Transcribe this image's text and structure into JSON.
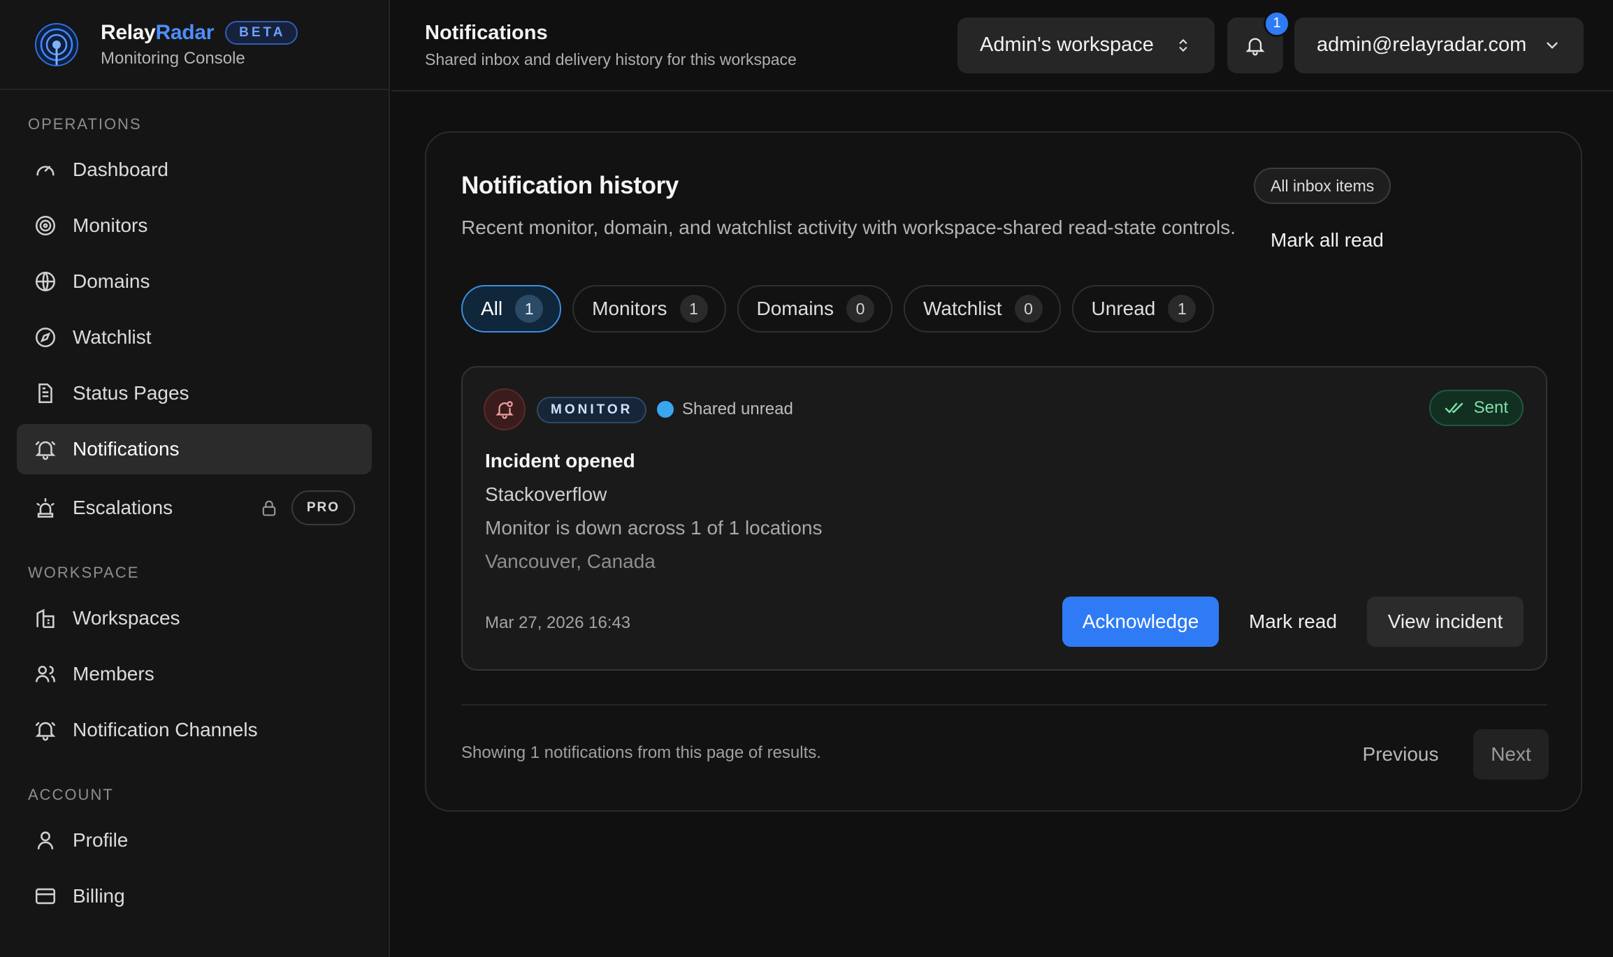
{
  "brand": {
    "name_part1": "Relay",
    "name_part2": "Radar",
    "badge": "BETA",
    "subtitle": "Monitoring Console",
    "logo_icon": "radar-icon"
  },
  "sidebar": {
    "sections": [
      {
        "heading": "OPERATIONS",
        "items": [
          {
            "label": "Dashboard",
            "icon": "gauge-icon"
          },
          {
            "label": "Monitors",
            "icon": "target-icon"
          },
          {
            "label": "Domains",
            "icon": "globe-icon"
          },
          {
            "label": "Watchlist",
            "icon": "compass-icon"
          },
          {
            "label": "Status Pages",
            "icon": "document-icon"
          },
          {
            "label": "Notifications",
            "icon": "bell-icon",
            "active": true
          },
          {
            "label": "Escalations",
            "icon": "siren-icon",
            "badge": "PRO",
            "locked": true
          }
        ]
      },
      {
        "heading": "WORKSPACE",
        "items": [
          {
            "label": "Workspaces",
            "icon": "building-icon"
          },
          {
            "label": "Members",
            "icon": "users-icon"
          },
          {
            "label": "Notification Channels",
            "icon": "bell-icon"
          }
        ]
      },
      {
        "heading": "ACCOUNT",
        "items": [
          {
            "label": "Profile",
            "icon": "user-icon"
          },
          {
            "label": "Billing",
            "icon": "credit-card-icon"
          }
        ]
      }
    ]
  },
  "header": {
    "title": "Notifications",
    "subtitle": "Shared inbox and delivery history for this workspace",
    "workspace": "Admin's workspace",
    "notification_count": "1",
    "user_email": "admin@relayradar.com"
  },
  "history": {
    "title": "Notification history",
    "description": "Recent monitor, domain, and watchlist activity with workspace-shared read-state controls.",
    "filter_pill": "All inbox items",
    "mark_all": "Mark all read",
    "tabs": [
      {
        "label": "All",
        "count": "1",
        "active": true
      },
      {
        "label": "Monitors",
        "count": "1"
      },
      {
        "label": "Domains",
        "count": "0"
      },
      {
        "label": "Watchlist",
        "count": "0"
      },
      {
        "label": "Unread",
        "count": "1"
      }
    ],
    "notification": {
      "tag": "MONITOR",
      "state": "Shared unread",
      "delivery": "Sent",
      "title": "Incident opened",
      "name": "Stackoverflow",
      "message": "Monitor is down across 1 of 1 locations",
      "location": "Vancouver, Canada",
      "timestamp": "Mar 27, 2026 16:43",
      "actions": {
        "acknowledge": "Acknowledge",
        "mark_read": "Mark read",
        "view": "View incident"
      }
    },
    "footer": {
      "summary": "Showing 1 notifications from this page of results.",
      "previous": "Previous",
      "next": "Next"
    }
  },
  "colors": {
    "accent": "#2f7bf5",
    "brand_blue": "#4c8dff",
    "sent_green": "#7fe0a8",
    "unread_dot": "#3aa6f0"
  }
}
